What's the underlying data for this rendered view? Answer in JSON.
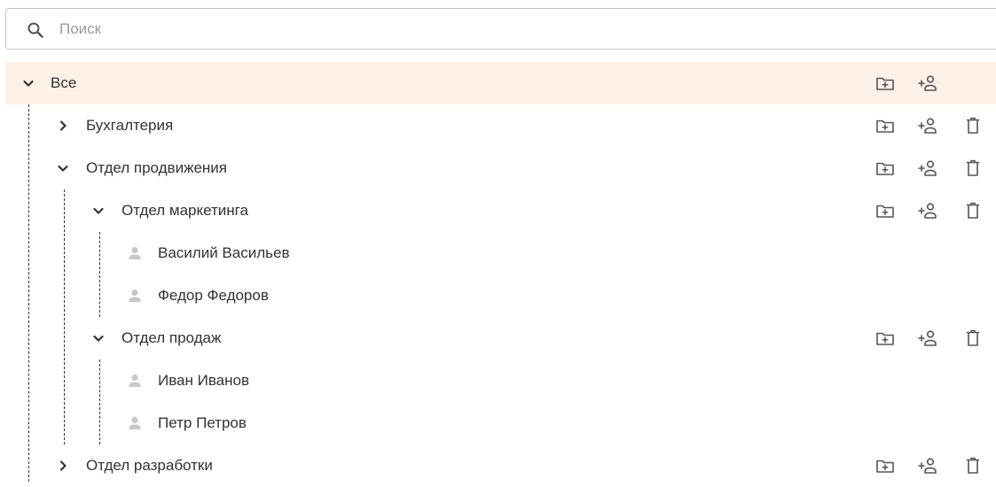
{
  "search": {
    "placeholder": "Поиск",
    "value": "",
    "icon": "search-icon"
  },
  "tree": {
    "root": {
      "label": "Все",
      "expanded": true,
      "actions": [
        "add-folder-icon",
        "add-user-icon"
      ]
    },
    "items": [
      {
        "label": "Бухгалтерия",
        "type": "group",
        "expanded": false,
        "actions": [
          "add-folder-icon",
          "add-user-icon",
          "delete-icon"
        ]
      },
      {
        "label": "Отдел продвижения",
        "type": "group",
        "expanded": true,
        "actions": [
          "add-folder-icon",
          "add-user-icon",
          "delete-icon"
        ]
      },
      {
        "label": "Отдел маркетинга",
        "type": "group",
        "expanded": true,
        "actions": [
          "add-folder-icon",
          "add-user-icon",
          "delete-icon"
        ]
      },
      {
        "label": "Василий Васильев",
        "type": "user"
      },
      {
        "label": "Федор Федоров",
        "type": "user"
      },
      {
        "label": "Отдел продаж",
        "type": "group",
        "expanded": true,
        "actions": [
          "add-folder-icon",
          "add-user-icon",
          "delete-icon"
        ]
      },
      {
        "label": "Иван Иванов",
        "type": "user"
      },
      {
        "label": "Петр Петров",
        "type": "user"
      },
      {
        "label": "Отдел разработки",
        "type": "group",
        "expanded": false,
        "actions": [
          "add-folder-icon",
          "add-user-icon",
          "delete-icon"
        ]
      }
    ]
  },
  "colors": {
    "root_highlight": "#fdf1e8",
    "icon": "#555555",
    "person_icon": "#c8c8c8",
    "text": "#333333"
  }
}
